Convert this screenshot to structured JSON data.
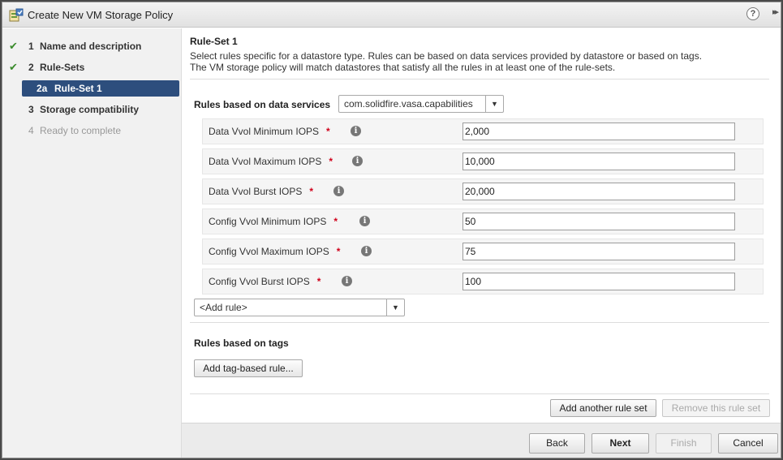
{
  "dialog": {
    "title": "Create New VM Storage Policy",
    "help_glyph": "?",
    "expand_glyph": "▸▸"
  },
  "steps": [
    {
      "num": "1",
      "label": "Name and description",
      "status": "done"
    },
    {
      "num": "2",
      "label": "Rule-Sets",
      "status": "done"
    },
    {
      "num": "2a",
      "label": "Rule-Set 1",
      "status": "active"
    },
    {
      "num": "3",
      "label": "Storage compatibility",
      "status": "pending"
    },
    {
      "num": "4",
      "label": "Ready to complete",
      "status": "disabled"
    }
  ],
  "ruleset": {
    "title": "Rule-Set 1",
    "desc_line1": "Select rules specific for a datastore type. Rules can be based on data services provided by datastore or based on tags.",
    "desc_line2": "The VM storage policy will match datastores that satisfy all the rules in at least one of the rule-sets.",
    "data_services_label": "Rules based on data services",
    "provider_value": "com.solidfire.vasa.capabilities",
    "rules": [
      {
        "label": "Data Vvol Minimum IOPS",
        "value": "2,000"
      },
      {
        "label": "Data Vvol Maximum IOPS",
        "value": "10,000"
      },
      {
        "label": "Data Vvol Burst IOPS",
        "value": "20,000"
      },
      {
        "label": "Config Vvol Minimum IOPS",
        "value": "50"
      },
      {
        "label": "Config Vvol Maximum IOPS",
        "value": "75"
      },
      {
        "label": "Config Vvol Burst IOPS",
        "value": "100"
      }
    ],
    "required_marker": "*",
    "info_glyph": "i",
    "add_rule_value": "<Add rule>",
    "tags_label": "Rules based on tags",
    "add_tag_rule_label": "Add tag-based rule...",
    "add_rule_set_label": "Add another rule set",
    "remove_rule_set_label": "Remove this rule set"
  },
  "footer": {
    "back": "Back",
    "next": "Next",
    "finish": "Finish",
    "cancel": "Cancel"
  },
  "colors": {
    "active_step": "#2d4e7d",
    "check": "#3a8b2c",
    "required": "#d0021b"
  }
}
